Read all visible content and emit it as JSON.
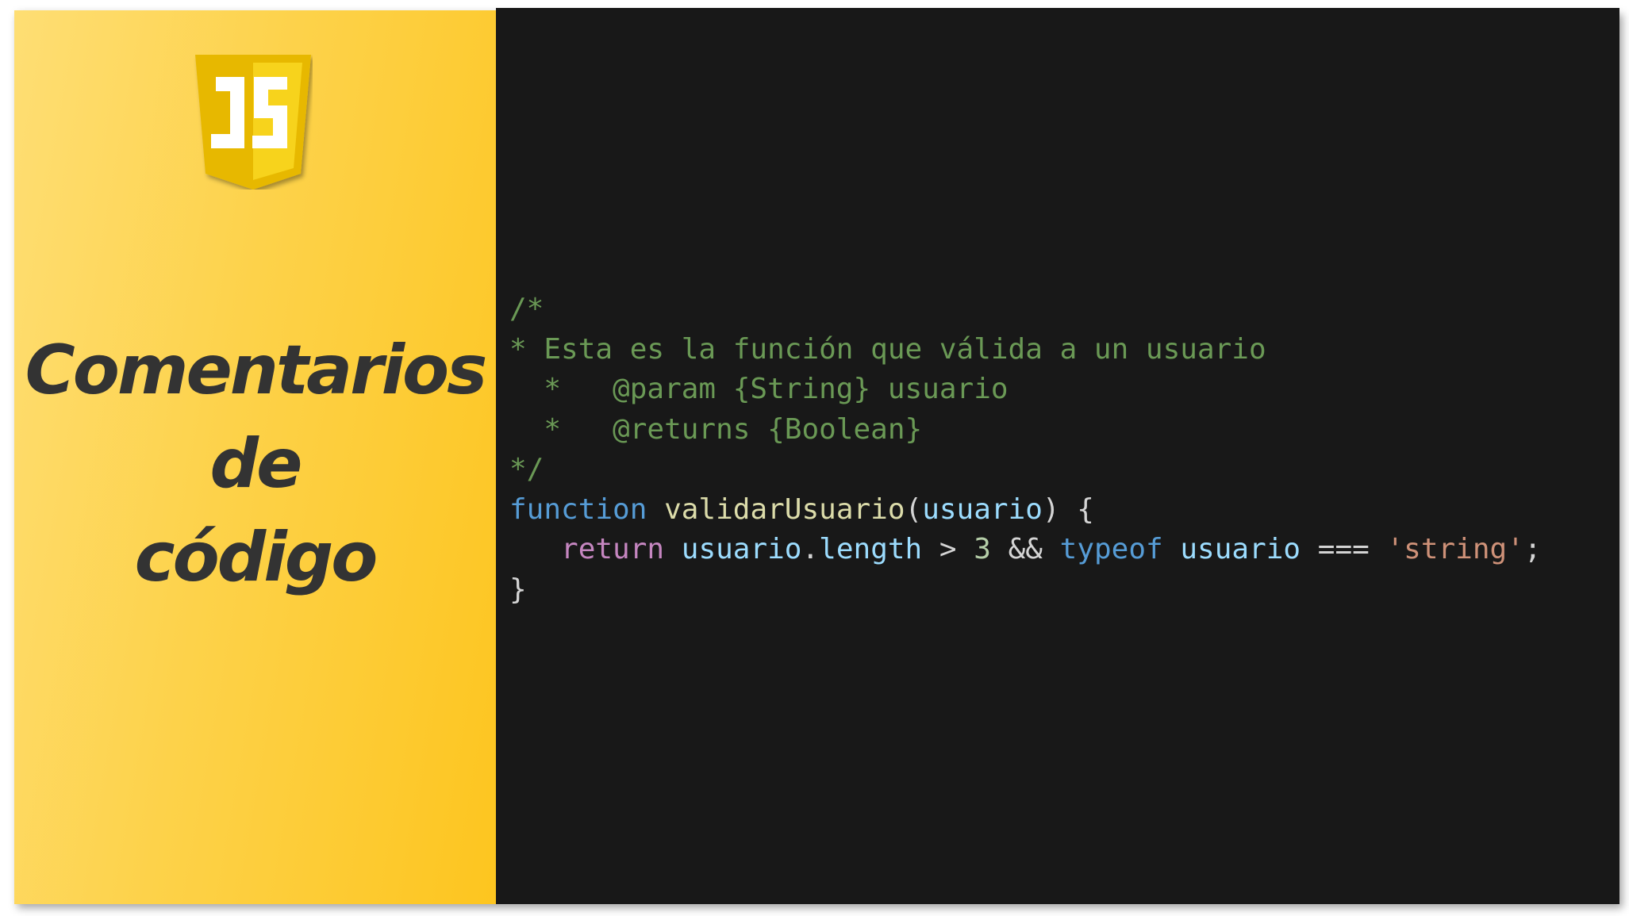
{
  "title": {
    "line1": "Comentarios",
    "line2": "de",
    "line3": "código"
  },
  "logo": {
    "icon": "javascript-shield-icon",
    "text": "JS"
  },
  "colors": {
    "panel_yellow": "#fdc51f",
    "code_background": "#181818",
    "comment": "#6a9955",
    "keyword": "#569cd6",
    "function_name": "#dcdcaa",
    "variable": "#9cdcfe",
    "control": "#c586c0",
    "number": "#b5cea8",
    "string": "#ce9178"
  },
  "code": {
    "line1": "/*",
    "line2": "* Esta es la función que válida a un usuario",
    "line3": "  *   @param {String} usuario",
    "line4": "  *   @returns {Boolean}",
    "line5": "*/",
    "line6": {
      "keyword": "function",
      "space1": " ",
      "name": "validarUsuario",
      "open_paren": "(",
      "param": "usuario",
      "close": ") {"
    },
    "line7": {
      "indent": "   ",
      "ret": "return",
      "sp1": " ",
      "var1": "usuario",
      "dot": ".",
      "prop": "length",
      "op1": " > ",
      "num": "3",
      "op2": " && ",
      "typeof": "typeof",
      "sp2": " ",
      "var2": "usuario",
      "op3": " === ",
      "str": "'string'",
      "semi": ";"
    },
    "line8": "}"
  }
}
